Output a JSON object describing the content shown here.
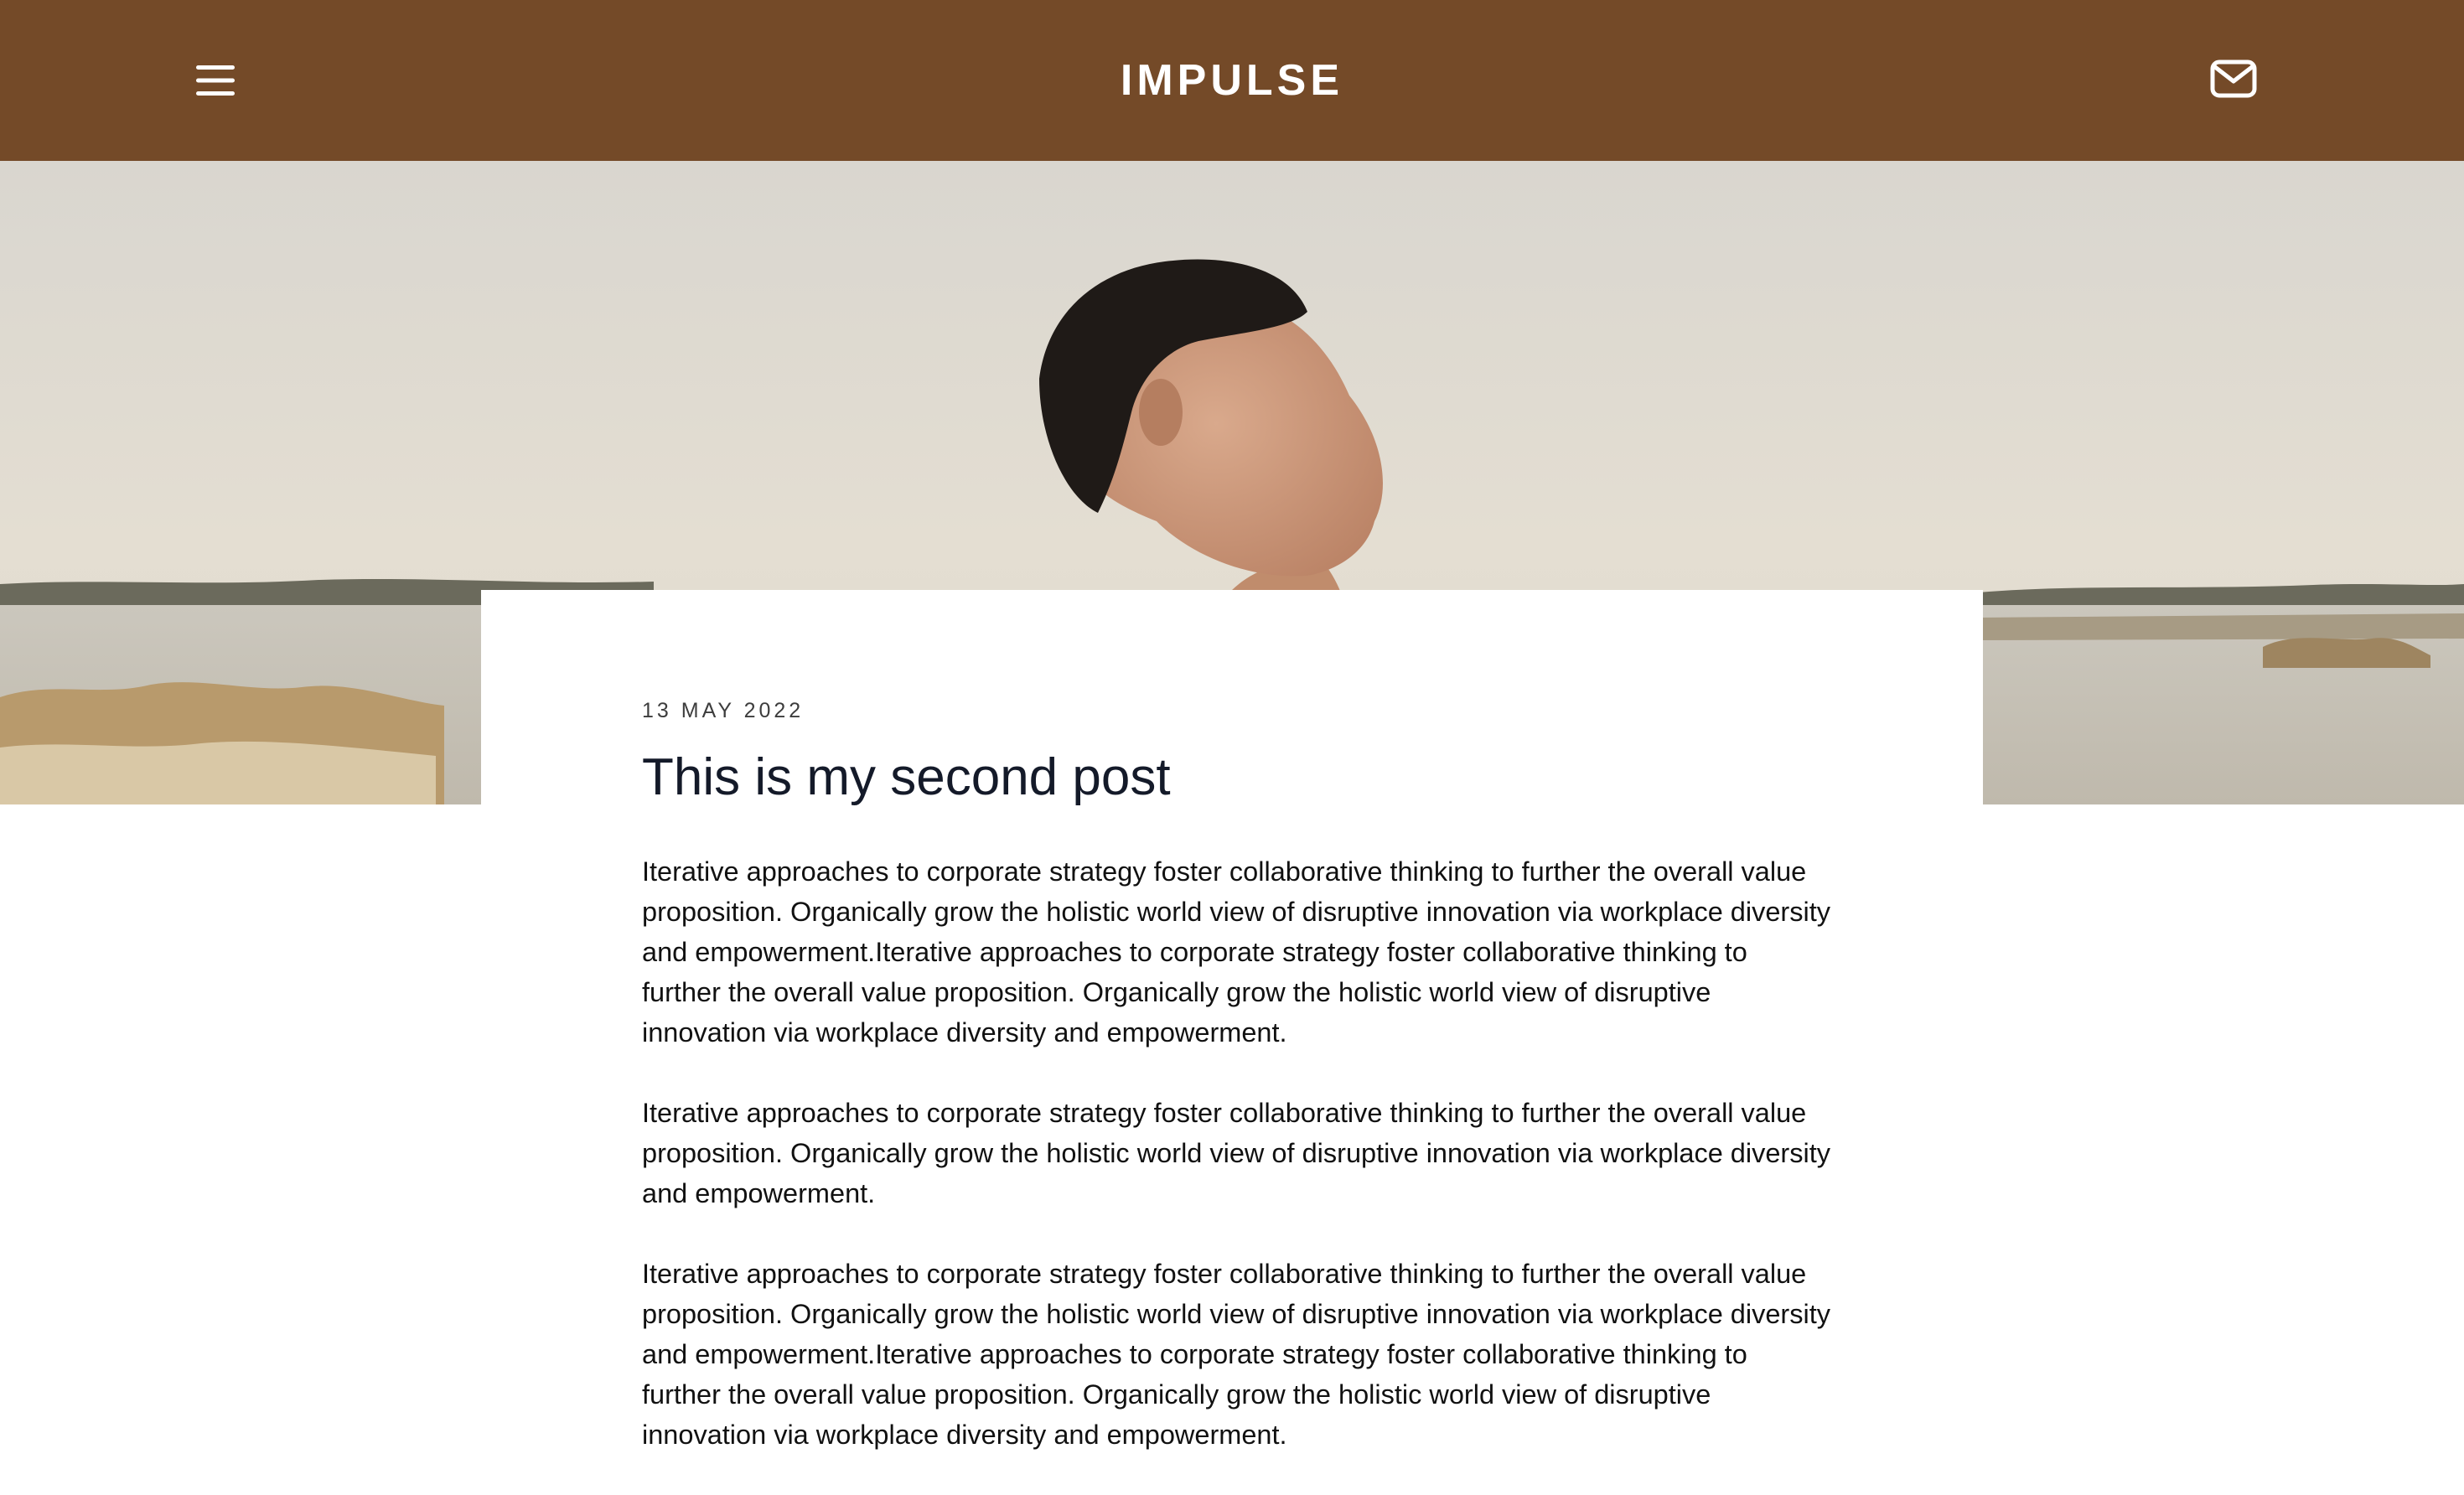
{
  "header": {
    "title": "IMPULSE",
    "background_color": "#744a28",
    "menu_icon": "hamburger-menu-icon",
    "mail_icon": "mail-envelope-icon"
  },
  "hero": {
    "description_icon": "hero-photo"
  },
  "post": {
    "date": "13 MAY 2022",
    "title": "This is my second post",
    "paragraphs": [
      "Iterative approaches to corporate strategy foster collaborative thinking to further the overall value proposition. Organically grow the holistic world view of disruptive innovation via workplace diversity and empowerment.Iterative approaches to corporate strategy foster collaborative thinking to further the overall value proposition. Organically grow the holistic world view of disruptive innovation via workplace diversity and empowerment.",
      "Iterative approaches to corporate strategy foster collaborative thinking to further the overall value proposition. Organically grow the holistic world view of disruptive innovation via workplace diversity and empowerment.",
      "Iterative approaches to corporate strategy foster collaborative thinking to further the overall value proposition. Organically grow the holistic world view of disruptive innovation via workplace diversity and empowerment.Iterative approaches to corporate strategy foster collaborative thinking to further the overall value proposition. Organically grow the holistic world view of disruptive innovation via workplace diversity and empowerment."
    ]
  }
}
